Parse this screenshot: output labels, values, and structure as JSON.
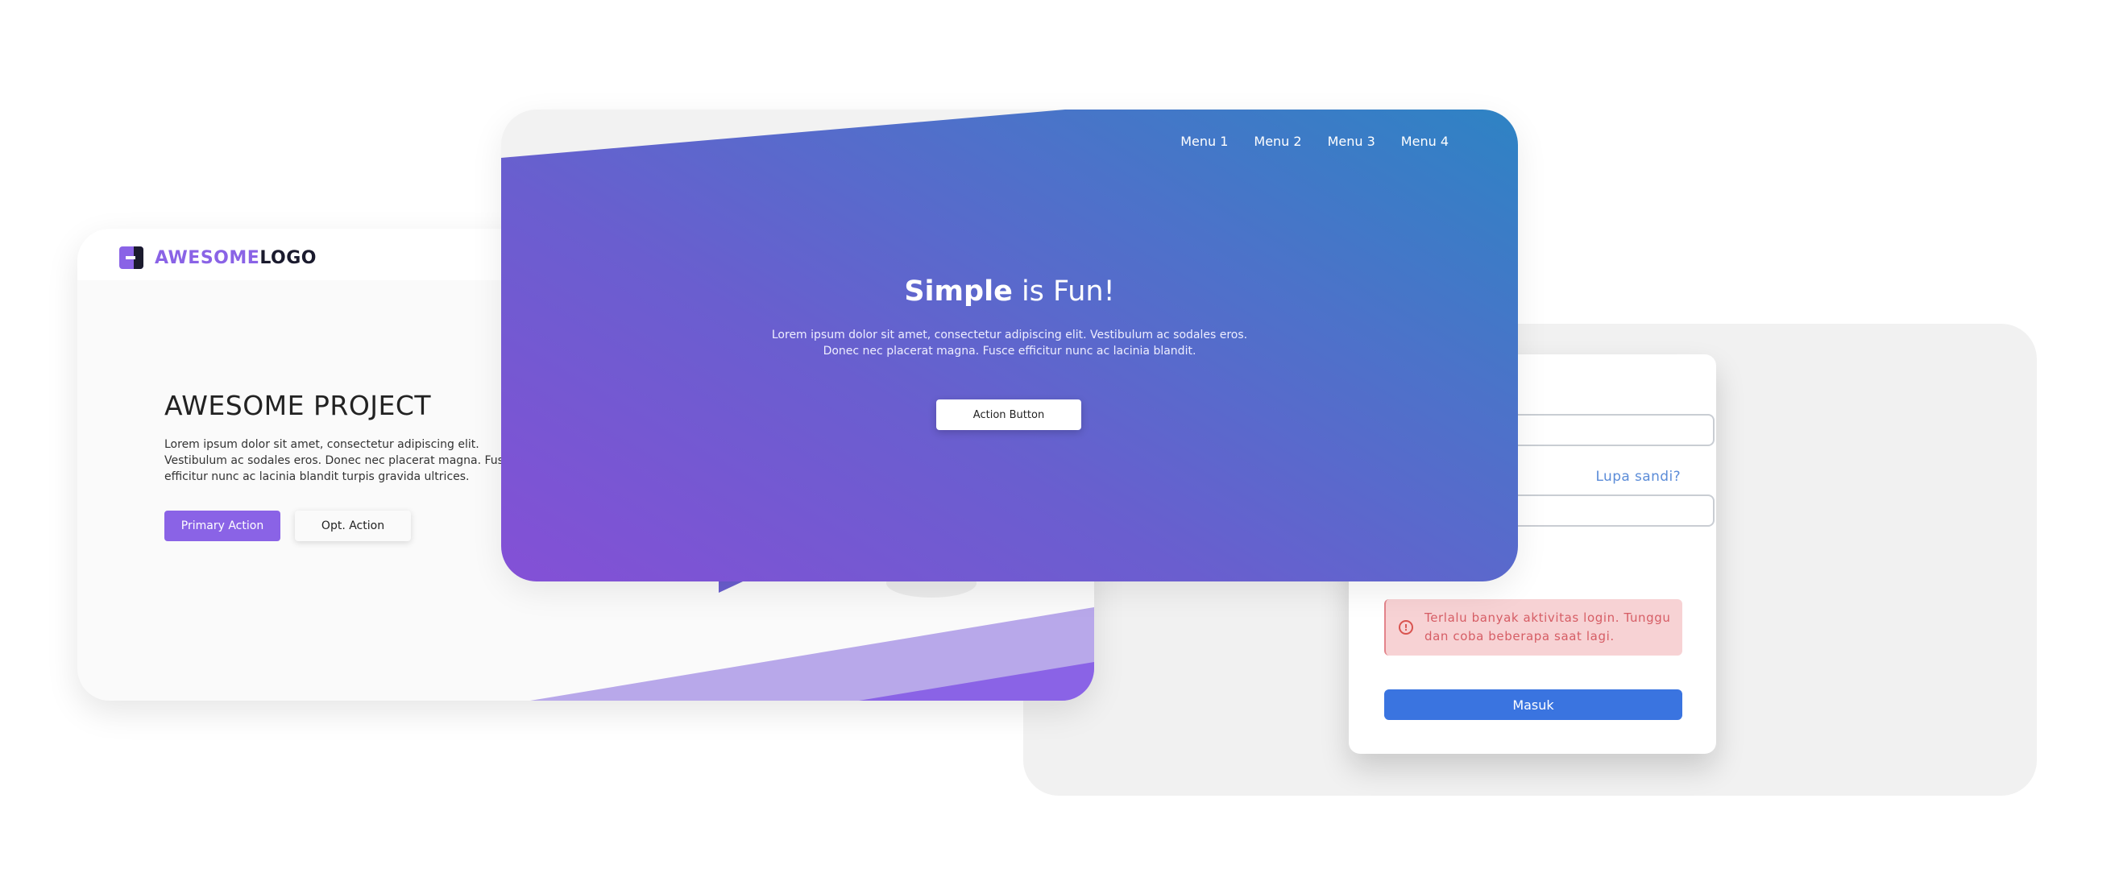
{
  "project_card": {
    "logo_primary": "AWESOME",
    "logo_secondary": "LOGO",
    "title": "AWESOME PROJECT",
    "description": "Lorem ipsum dolor sit amet, consectetur adipiscing elit. Vestibulum ac sodales eros. Donec nec placerat magna. Fusce efficitur nunc ac lacinia blandit turpis gravida ultrices.",
    "primary_action": "Primary Action",
    "optional_action": "Opt. Action",
    "accent_color": "#8a63e6"
  },
  "hero_card": {
    "menu": [
      "Menu 1",
      "Menu 2",
      "Menu 3",
      "Menu 4"
    ],
    "title_bold": "Simple",
    "title_rest": " is Fun!",
    "description": "Lorem ipsum dolor sit amet, consectetur adipiscing elit. Vestibulum ac sodales eros. Donec nec placerat magna. Fusce efficitur nunc ac lacinia blandit.",
    "action_button": "Action Button",
    "gradient_start": "#8450d6",
    "gradient_end": "#2e83c4"
  },
  "login_card": {
    "forgot_link": "Lupa sandi?",
    "alert_icon": "alert-circle-icon",
    "alert_message": "Terlalu banyak aktivitas login. Tunggu dan coba beberapa saat lagi.",
    "submit_button": "Masuk",
    "button_color": "#3a74e0",
    "alert_color": "#f7d2d4"
  }
}
